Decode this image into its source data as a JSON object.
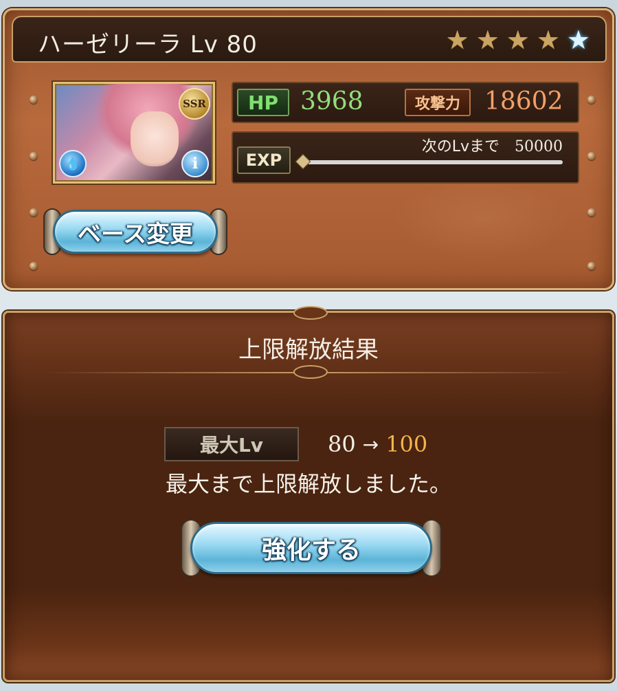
{
  "character": {
    "name_level": "ハーゼリーラ Lv 80",
    "rarity_badge": "SSR",
    "stars": [
      "gold",
      "gold",
      "gold",
      "gold",
      "blue"
    ]
  },
  "stats": {
    "hp_label": "HP",
    "hp_value": "3968",
    "atk_label": "攻撃力",
    "atk_value": "18602",
    "exp_label": "EXP",
    "next_lv_label": "次のLvまで",
    "next_lv_value": "50000"
  },
  "base_change_button": "ベース変更",
  "result": {
    "title": "上限解放結果",
    "max_lv_label": "最大Lv",
    "from_level": "80",
    "arrow": "→",
    "to_level": "100",
    "message": "最大まで上限解放しました。",
    "enhance_button": "強化する"
  },
  "colors": {
    "hp_value": "#8fe07c",
    "atk_value": "#f3a06a",
    "new_level": "#f2b54a",
    "button_blue": "#9fdcf3"
  },
  "icons": {
    "element": "water-element-icon",
    "info": "info-icon",
    "star": "star-icon"
  }
}
